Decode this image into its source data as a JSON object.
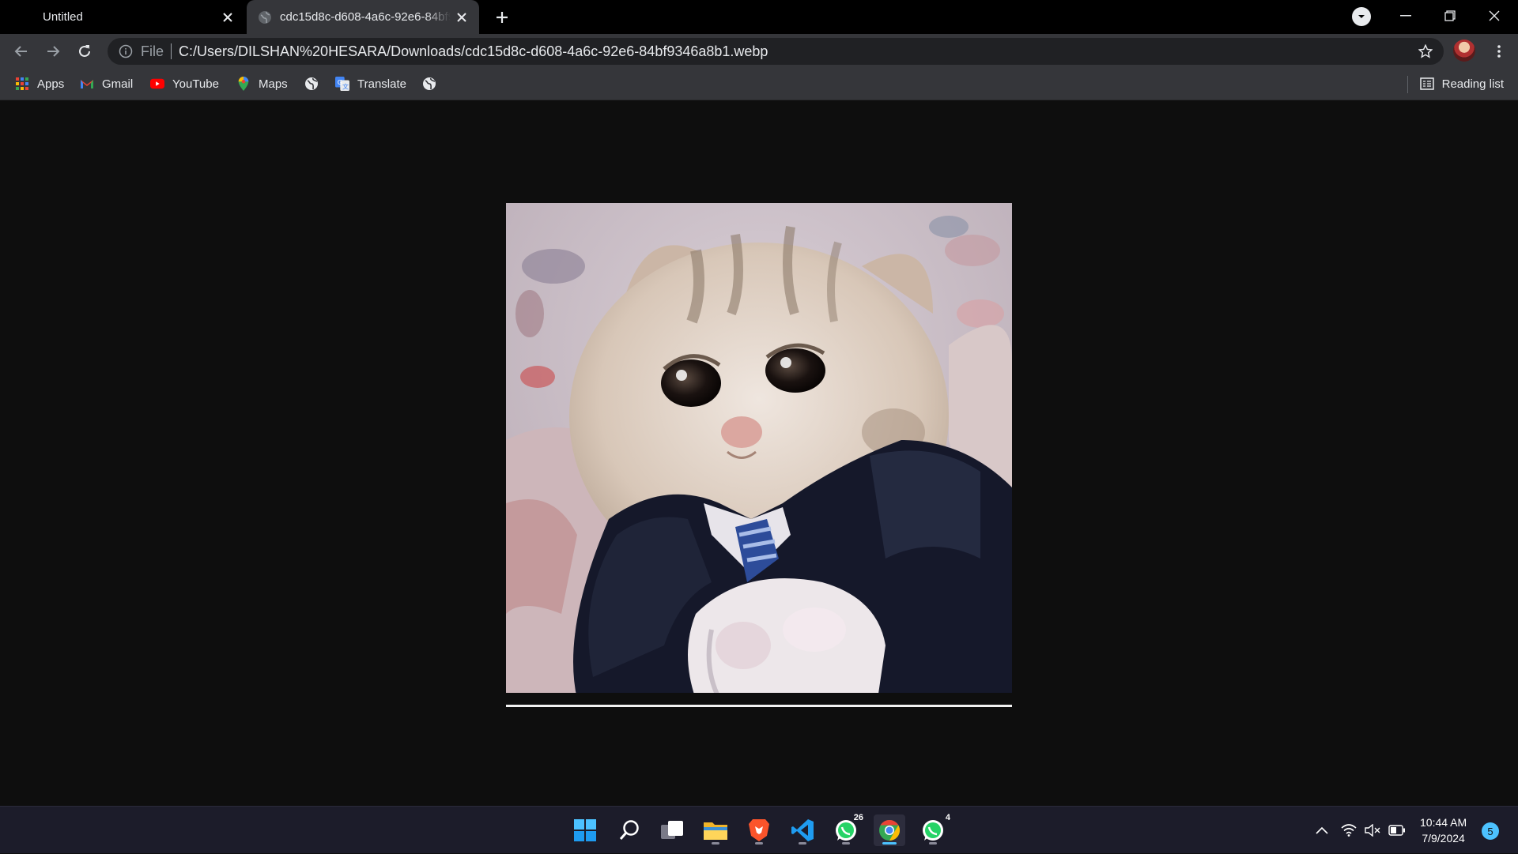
{
  "browser": {
    "tabs": [
      {
        "title": "Untitled",
        "active": false
      },
      {
        "title": "cdc15d8c-d608-4a6c-92e6-84bf9346a8b1.webp",
        "active": true
      }
    ],
    "omnibox": {
      "scheme_label": "File",
      "url": "C:/Users/DILSHAN%20HESARA/Downloads/cdc15d8c-d608-4a6c-92e6-84bf9346a8b1.webp"
    },
    "bookmarks": [
      {
        "label": "Apps",
        "icon": "apps-grid-icon"
      },
      {
        "label": "Gmail",
        "icon": "gmail-icon"
      },
      {
        "label": "YouTube",
        "icon": "youtube-icon"
      },
      {
        "label": "Maps",
        "icon": "maps-icon"
      },
      {
        "label": "",
        "icon": "globe-icon"
      },
      {
        "label": "Translate",
        "icon": "translate-icon"
      },
      {
        "label": "",
        "icon": "globe-icon"
      }
    ],
    "reading_list_label": "Reading list"
  },
  "image": {
    "description_icon": "crying-cat-in-suit-photo"
  },
  "taskbar": {
    "apps": [
      {
        "name": "start",
        "badge": ""
      },
      {
        "name": "search",
        "badge": ""
      },
      {
        "name": "task-view",
        "badge": ""
      },
      {
        "name": "file-explorer",
        "badge": ""
      },
      {
        "name": "brave",
        "badge": ""
      },
      {
        "name": "vscode",
        "badge": ""
      },
      {
        "name": "whatsapp",
        "badge": "26"
      },
      {
        "name": "chrome",
        "badge": ""
      },
      {
        "name": "whatsapp-business",
        "badge": "4"
      }
    ],
    "time": "10:44 AM",
    "date": "7/9/2024",
    "notification_count": "5"
  },
  "colors": {
    "tab_bg": "#000000",
    "toolbar_bg": "#35363a",
    "page_bg": "#0e0e0e",
    "taskbar_bg": "#1c1c2a",
    "accent": "#4cc2ff"
  }
}
